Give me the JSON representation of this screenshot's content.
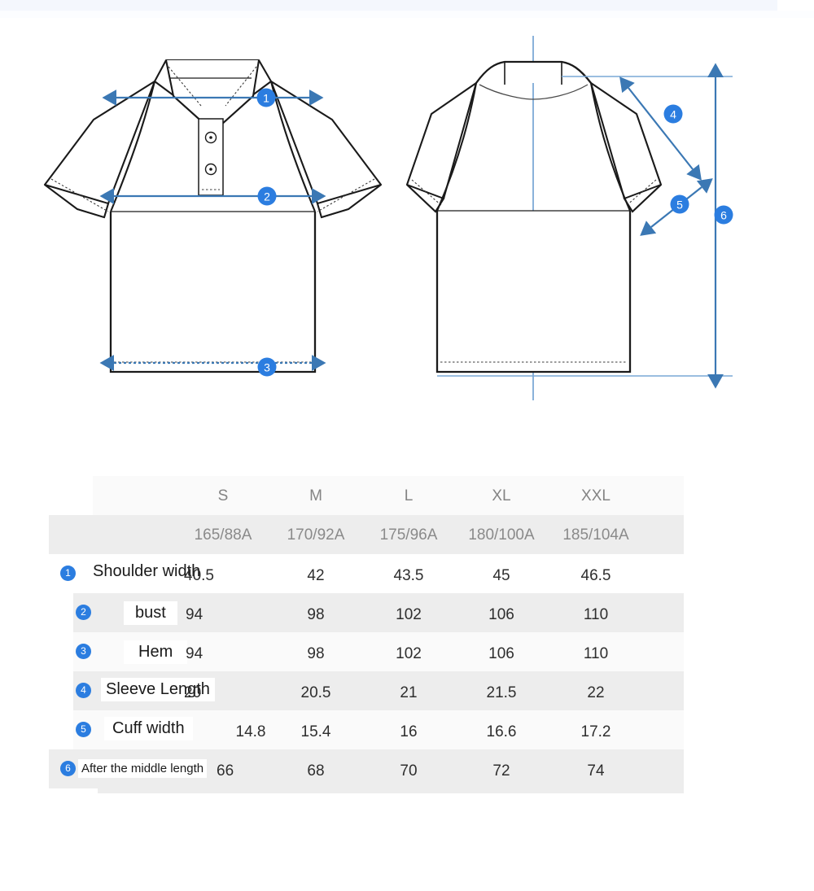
{
  "diagram": {
    "title": "polo-shirt-measurement-diagram",
    "front_view": {
      "name": "front-view",
      "markers": [
        {
          "id": "1",
          "measure": "Shoulder width",
          "style": "solid-double-arrow",
          "orientation": "horizontal"
        },
        {
          "id": "2",
          "measure": "bust",
          "style": "solid-double-arrow",
          "orientation": "horizontal"
        },
        {
          "id": "3",
          "measure": "Hem",
          "style": "dotted-double-arrow",
          "orientation": "horizontal"
        }
      ]
    },
    "back_view": {
      "name": "back-view",
      "markers": [
        {
          "id": "4",
          "measure": "Sleeve Length",
          "style": "solid-double-arrow",
          "orientation": "diagonal"
        },
        {
          "id": "5",
          "measure": "Cuff width",
          "style": "solid-double-arrow",
          "orientation": "diagonal"
        },
        {
          "id": "6",
          "measure": "After the middle length",
          "style": "solid-double-arrow",
          "orientation": "vertical"
        }
      ]
    },
    "colors": {
      "arrow_blue": "#3b78b4",
      "badge_blue": "#2b7de0",
      "guide_blue": "#7aa8d6",
      "outline_black": "#1a1a1a"
    }
  },
  "table": {
    "name": "size-chart-table",
    "size_header": [
      "S",
      "M",
      "L",
      "XL",
      "XXL"
    ],
    "spec_header": [
      "165/88A",
      "170/92A",
      "175/96A",
      "180/100A",
      "185/104A"
    ],
    "rows": [
      {
        "num": "1",
        "label": "Shoulder width",
        "values": [
          "40.5",
          "42",
          "43.5",
          "45",
          "46.5"
        ]
      },
      {
        "num": "2",
        "label": "bust",
        "values": [
          "94",
          "98",
          "102",
          "106",
          "110"
        ]
      },
      {
        "num": "3",
        "label": "Hem",
        "values": [
          "94",
          "98",
          "102",
          "106",
          "110"
        ]
      },
      {
        "num": "4",
        "label": "Sleeve Length",
        "values": [
          "20",
          "20.5",
          "21",
          "21.5",
          "22"
        ]
      },
      {
        "num": "5",
        "label": "Cuff width",
        "values": [
          "14.8",
          "15.4",
          "16",
          "16.6",
          "17.2"
        ]
      },
      {
        "num": "6",
        "label": "After the middle length",
        "values": [
          "66",
          "68",
          "70",
          "72",
          "74"
        ]
      }
    ]
  }
}
